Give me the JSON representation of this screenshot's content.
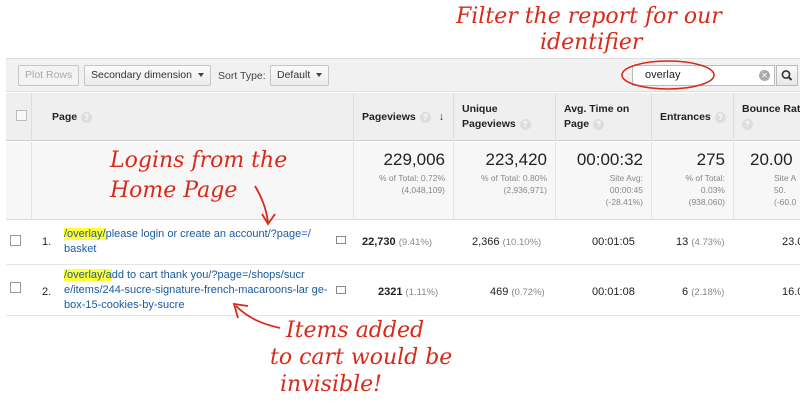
{
  "toolbar": {
    "plot_rows": "Plot Rows",
    "secondary_dimension": "Secondary dimension",
    "sort_type_label": "Sort Type:",
    "sort_type_value": "Default",
    "search_value": "overlay"
  },
  "columns": {
    "page": "Page",
    "pageviews": "Pageviews",
    "unique_pageviews": "Unique Pageviews",
    "avg_time": "Avg. Time on Page",
    "entrances": "Entrances",
    "bounce_rate": "Bounce Rat"
  },
  "totals": {
    "pageviews": {
      "value": "229,006",
      "sub1": "% of Total: 0.72%",
      "sub2": "(4,048,109)"
    },
    "unique": {
      "value": "223,420",
      "sub1": "% of Total: 0.80%",
      "sub2": "(2,936,971)"
    },
    "avg_time": {
      "value": "00:00:32",
      "sub1": "Site Avg:",
      "sub2": "00:00:45",
      "sub3": "(-28.41%)"
    },
    "entrances": {
      "value": "275",
      "sub1": "% of Total:",
      "sub2": "0.03%",
      "sub3": "(938,060)"
    },
    "bounce": {
      "value": "20.00",
      "sub1": "Site A",
      "sub2": "50.",
      "sub3": "(-60.0"
    }
  },
  "rows": [
    {
      "num": "1.",
      "page_hl": "/overlay/",
      "page_rest": "please login or create an account/?page=/ basket",
      "pageviews": "22,730",
      "pageviews_pct": "(9.41%)",
      "unique": "2,366",
      "unique_pct": "(10.10%)",
      "avg_time": "00:01:05",
      "entrances": "13",
      "entrances_pct": "(4.73%)",
      "bounce": "23.0"
    },
    {
      "num": "2.",
      "page_hl": "/overlay/a",
      "page_rest": "dd to cart thank you/?page=/shops/sucr e/items/244-sucre-signature-french-macaroons-lar ge-box-15-cookies-by-sucre",
      "pageviews": "2321",
      "pageviews_pct": "(1.11%)",
      "unique": "469",
      "unique_pct": "(0.72%)",
      "avg_time": "00:01:08",
      "entrances": "6",
      "entrances_pct": "(2.18%)",
      "bounce": "16.0"
    }
  ],
  "annotations": {
    "filter_line1": "Filter the report for our",
    "filter_line2": "identifier",
    "logins_line1": "Logins from the",
    "logins_line2": "Home Page",
    "items_line1": "Items added",
    "items_line2": "to cart would be",
    "items_line3": "invisible!"
  },
  "colors": {
    "annotation": "#d82a1a",
    "link": "#1a5aa0",
    "highlight": "#ffff33"
  }
}
